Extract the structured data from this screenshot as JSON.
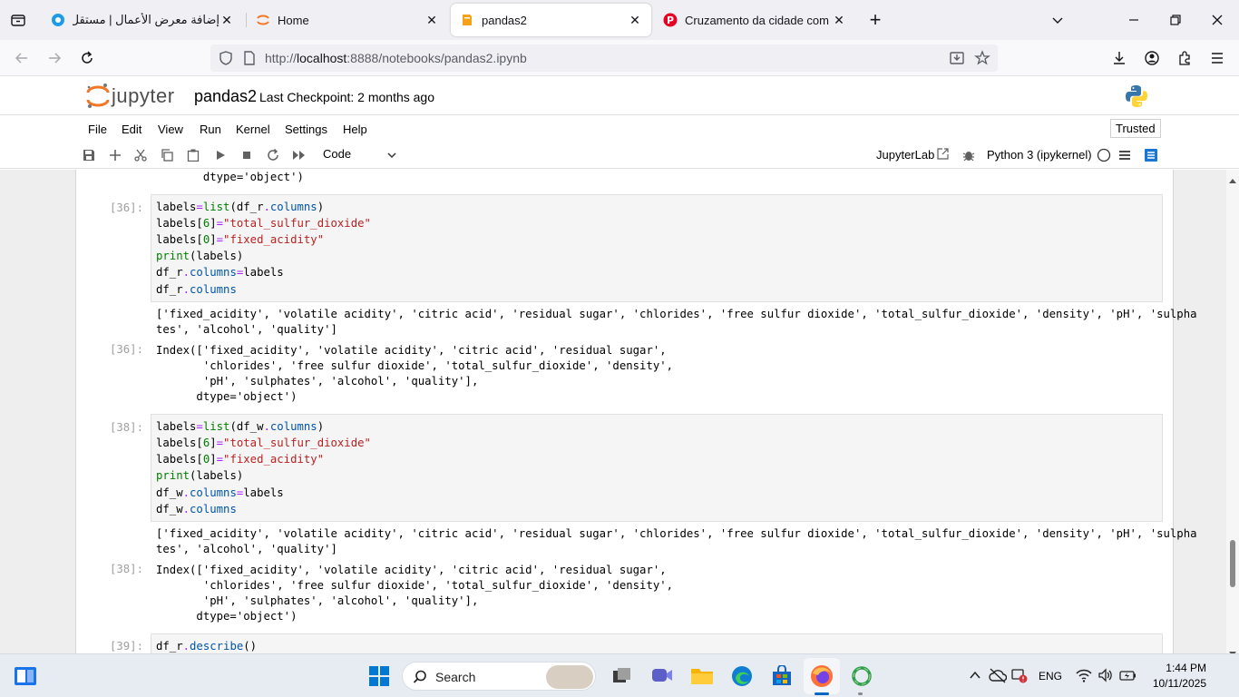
{
  "browser": {
    "tabs": [
      {
        "title": "إضافة معرض الأعمال | مستقل",
        "icon": "mostaql-icon"
      },
      {
        "title": "Home",
        "icon": "jupyter-icon"
      },
      {
        "title": "pandas2",
        "icon": "notebook-icon",
        "active": true
      },
      {
        "title": "Cruzamento da cidade com sen",
        "icon": "pinterest-icon"
      }
    ],
    "close_glyph": "✕",
    "new_tab_glyph": "+",
    "url_prefix": "http://",
    "url_host": "localhost",
    "url_rest": ":8888/notebooks/pandas2.ipynb"
  },
  "jupyter": {
    "logo_text": "jupyter",
    "notebook_name": "pandas2",
    "checkpoint": "Last Checkpoint: 2 months ago",
    "menu": [
      "File",
      "Edit",
      "View",
      "Run",
      "Kernel",
      "Settings",
      "Help"
    ],
    "trusted": "Trusted",
    "cell_type": "Code",
    "jupyterlab_link": "JupyterLab",
    "kernel": "Python 3 (ipykernel)"
  },
  "cells": {
    "prev_tail": "       dtype='object')",
    "c36": {
      "prompt_in": "[36]:",
      "prompt_out": "[36]:",
      "print_out_1": "['fixed_acidity', 'volatile acidity', 'citric acid', 'residual sugar', 'chlorides', 'free sulfur dioxide', 'total_sulfur_dioxide', 'density', 'pH', 'sulpha",
      "print_out_2": "tes', 'alcohol', 'quality']",
      "index_1": "Index(['fixed_acidity', 'volatile acidity', 'citric acid', 'residual sugar',",
      "index_2": "       'chlorides', 'free sulfur dioxide', 'total_sulfur_dioxide', 'density',",
      "index_3": "       'pH', 'sulphates', 'alcohol', 'quality'],",
      "index_4": "      dtype='object')"
    },
    "c38": {
      "prompt_in": "[38]:",
      "prompt_out": "[38]:",
      "print_out_1": "['fixed_acidity', 'volatile acidity', 'citric acid', 'residual sugar', 'chlorides', 'free sulfur dioxide', 'total_sulfur_dioxide', 'density', 'pH', 'sulpha",
      "print_out_2": "tes', 'alcohol', 'quality']",
      "index_1": "Index(['fixed_acidity', 'volatile acidity', 'citric acid', 'residual sugar',",
      "index_2": "       'chlorides', 'free sulfur dioxide', 'total_sulfur_dioxide', 'density',",
      "index_3": "       'pH', 'sulphates', 'alcohol', 'quality'],",
      "index_4": "      dtype='object')"
    },
    "c39": {
      "prompt_in": "[39]:"
    }
  },
  "taskbar": {
    "search": "Search",
    "lang": "ENG",
    "time": "1:44 PM",
    "date": "10/11/2025"
  },
  "colors": {
    "keyword": "#008000",
    "operator": "#aa22ff",
    "string": "#ba2121",
    "attribute": "#0055aa"
  }
}
